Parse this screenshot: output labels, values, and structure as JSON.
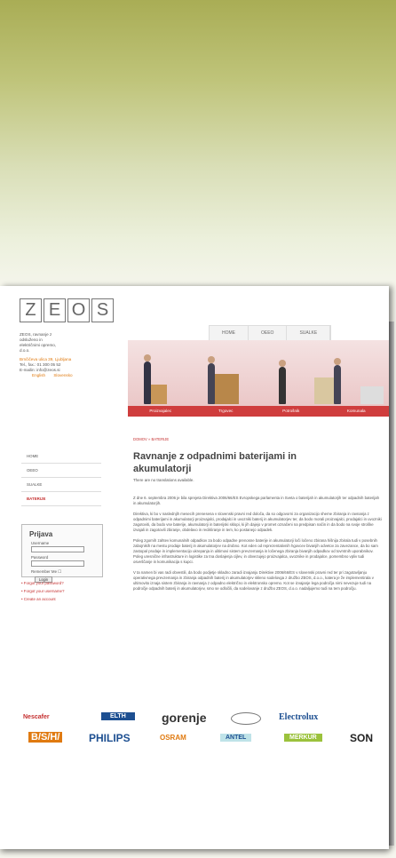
{
  "logo": {
    "letters": [
      "Z",
      "E",
      "O",
      "S"
    ]
  },
  "company": {
    "line1": "ZEOS, ravnanje z",
    "line2": "odsluženo in",
    "line3": "električnimi opremo,",
    "line4": "d.o.o.",
    "street": "Brnčičeva ulica 39, Ljubljana",
    "tel": "Tel., fax.: 01 300 05 52",
    "email": "E-mailin: info@zeos.si",
    "lang_en": "English",
    "lang_sl": "Slovensko"
  },
  "topnav": [
    "HOME",
    "OEEO",
    "SUALKE"
  ],
  "banner": {
    "captions": [
      "Proizvajalec",
      "Trgovec",
      "Potrošnik",
      "Komunala"
    ]
  },
  "breadcrumb": "DOMOV » BATERIJE",
  "page_title": "Ravnanje z odpadnimi baterijami in akumulatorji",
  "translation_note": "There are no translations available.",
  "sidenav": [
    "HOME",
    "OEEO",
    "SUALKE",
    "BATERIJE"
  ],
  "login": {
    "title": "Prijava",
    "username_label": "Username",
    "password_label": "Password",
    "remember_label": "Remember Me ☐",
    "login_button": "Login"
  },
  "links": [
    "Forgot your password?",
    "Forgot your username?",
    "Create an account"
  ],
  "paragraphs": [
    "Z dne 6. septembra 2006 je bila sprejeta Direktiva 2006/66/ES Evropskega parlamenta in Sveta o baterijah in akumulatorjih ter odpadnih baterijah in akumulatorjih.",
    "Direktiva, ki bo v naslednjih mesecih prenesena v slovenski pravni red določa, da so odgovorni za organizacijo sheme zbiranja in ravnanja z odpadnimi baterijami in akumulatorji proizvajalci, prodajalci in uvozniki baterij in akumulatorjev ter, da bodo morali proizvajalci, prodajalci in uvozniki zagotoviti, da bodo vse baterije, akumulatorji in baterijski sklopi, ki jih dajejo v promet označeni na predpisan način in da bodo na svoje stroške izvajali in zagotovili zbiranje, obdelavo in recikliranje in tem, ko postanejo odpadek.",
    "Poleg zgornih zahtev komunalnih odpadkov za bodo odpadne prenosne baterije in akumulatorji loči ločeno zbirana hišnija zbirala tudi v posebnih zabojnikih na mestu prodaje baterij in akumulatorjev na drobno. Kot eden od reprezentativnih hgovcev bivanjih odvetov za zavezance, da bo sam zastopal prodaje in implementacijo ukrepanja in ulitimovi sistem prevzemanja in ločenega zbiranja bivanjih odpadkov od tovrstnih uporabnikov. Poleg uresnične infrastrukture in logistike za tna doslajenja cijlev, in obvezujejo proizvajalca, uvoznike in prodajalce, pomembno vpliv tudi osveščanje in komunikacija s kupci.",
    "V ta namen bi vas radi obvestili, da bodo podjetje skladno zaradi izvajanju Direktive 2006/66/ES v slovenski pravni red ter pri zagotavljanju operativnega prevzemanja in zbiranja odpadnih baterij in akumulatorjev skleno sodelovga z družbo ZEOS, d.o.o., katera je že implementirala v ultimovito iznaja sistem zbiranja in ravnanja z odpadno električno in elektronsko opremo. Kot se izvajanje lega področja nimi nevezuje tudi na področje odpadnih baterij in akumulatorjev, smo se odločili, da sodelovanje z družbo ZEOS, d.o.o. nadaljujemo tudi na tem področju."
  ],
  "brands_row1": [
    "Nescafer",
    "ELTH",
    "gorenje",
    "Electrolux"
  ],
  "brands_row2": [
    "B/S/H/",
    "PHILIPS",
    "OSRAM",
    "ANTEL",
    "MERKUR",
    "SON"
  ]
}
